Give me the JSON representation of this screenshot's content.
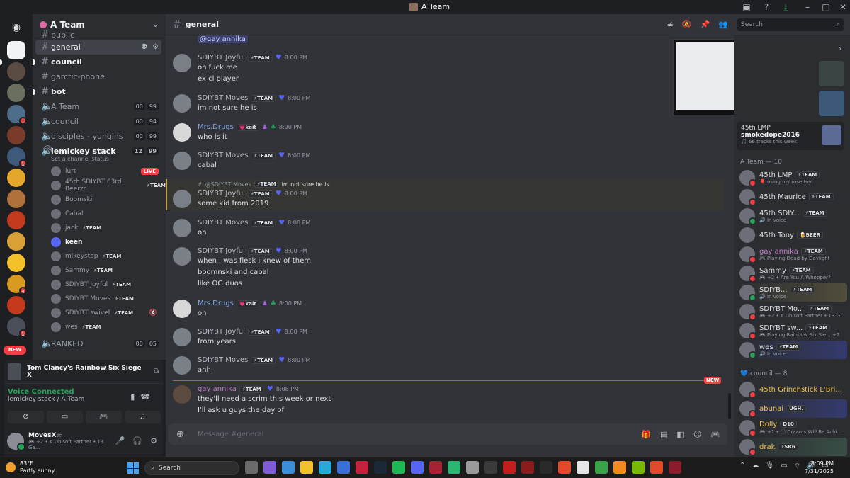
{
  "window": {
    "title": "A Team"
  },
  "server": {
    "name": "A Team",
    "new_label": "NEW"
  },
  "channels": [
    {
      "name": "public",
      "type": "text"
    },
    {
      "name": "general",
      "type": "text",
      "active": true
    },
    {
      "name": "council",
      "type": "text",
      "unread": true
    },
    {
      "name": "garctic-phone",
      "type": "text"
    },
    {
      "name": "bot",
      "type": "text",
      "unread": true
    },
    {
      "name": "A Team",
      "type": "voice",
      "c1": "00",
      "c2": "99"
    },
    {
      "name": "council",
      "type": "voice",
      "c1": "00",
      "c2": "94"
    },
    {
      "name": "disciples - yungins",
      "type": "voice",
      "c1": "00",
      "c2": "99"
    },
    {
      "name": "lemickey stack",
      "type": "voice",
      "c1": "12",
      "c2": "99",
      "status": "Set a channel status"
    }
  ],
  "voice_users": [
    {
      "name": "lurt",
      "live": "LIVE"
    },
    {
      "name": "45th SDIYBT 63rd Beerzr",
      "tag": "⚡TEAM"
    },
    {
      "name": "Boomski"
    },
    {
      "name": "Cabal"
    },
    {
      "name": "jack",
      "tag": "⚡TEAM"
    },
    {
      "name": "keen",
      "bold": true
    },
    {
      "name": "mikeystop",
      "tag": "⚡TEAM"
    },
    {
      "name": "Sammy",
      "tag": "⚡TEAM"
    },
    {
      "name": "SDIYBT Joyful",
      "tag": "⚡TEAM"
    },
    {
      "name": "SDIYBT Moves",
      "tag": "⚡TEAM"
    },
    {
      "name": "SDIYBT swivel",
      "tag": "⚡TEAM",
      "muted": true
    },
    {
      "name": "wes",
      "tag": "⚡TEAM"
    }
  ],
  "ranked": {
    "name": "RANKED",
    "c1": "00",
    "c2": "05"
  },
  "activity": {
    "game": "Tom Clancy's Rainbow Six Siege X",
    "voice_status": "Voice Connected",
    "voice_channel": "lemickey stack / A Team"
  },
  "user": {
    "name": "MovesX☆",
    "status": "🎮 +2 • ∀ Ubisoft Partner • T3 Ga..."
  },
  "chat": {
    "channel": "general",
    "mention": "@gay annika",
    "reply_preview": "@SDIYBT Moves",
    "reply_tag": "⚡TEAM",
    "reply_text": "im not sure he is",
    "new_label": "NEW",
    "placeholder": "Message #general",
    "messages": [
      {
        "author": "SDIYBT Joyful",
        "tag": "⚡TEAM",
        "time": "8:00 PM",
        "lines": [
          "oh fuck me",
          "ex cl player"
        ]
      },
      {
        "author": "SDIYBT Moves",
        "tag": "⚡TEAM",
        "time": "8:00 PM",
        "lines": [
          "im not sure he is"
        ]
      },
      {
        "author": "Mrs.Drugs",
        "tag": "💗kait",
        "time": "8:00 PM",
        "lines": [
          "who is it"
        ]
      },
      {
        "author": "SDIYBT Moves",
        "tag": "⚡TEAM",
        "time": "8:00 PM",
        "lines": [
          "cabal"
        ]
      },
      {
        "author": "SDIYBT Joyful",
        "tag": "⚡TEAM",
        "time": "8:00 PM",
        "lines": [
          "some kid from 2019"
        ]
      },
      {
        "author": "SDIYBT Moves",
        "tag": "⚡TEAM",
        "time": "8:00 PM",
        "lines": [
          "oh"
        ]
      },
      {
        "author": "SDIYBT Joyful",
        "tag": "⚡TEAM",
        "time": "8:00 PM",
        "lines": [
          "when i was flesk i knew of them",
          "boomnski and cabal",
          "like OG duos"
        ]
      },
      {
        "author": "Mrs.Drugs",
        "tag": "💗kait",
        "time": "8:00 PM",
        "lines": [
          "oh"
        ]
      },
      {
        "author": "SDIYBT Joyful",
        "tag": "⚡TEAM",
        "time": "8:00 PM",
        "lines": [
          "from years"
        ]
      },
      {
        "author": "SDIYBT Moves",
        "tag": "⚡TEAM",
        "time": "8:00 PM",
        "lines": [
          "ahh"
        ]
      },
      {
        "author": "gay annika",
        "tag": "⚡TEAM",
        "time": "8:08 PM",
        "lines": [
          "they'll need a scrim this week or next",
          "I'll ask u guys the day of"
        ]
      }
    ]
  },
  "search": {
    "placeholder": "Search"
  },
  "members": {
    "lmp_card": {
      "a": "45th LMP",
      "b": "smokedope2016",
      "c": "🎵 66 tracks this week"
    },
    "group1": "A Team — 10",
    "list1": [
      {
        "name": "45th LMP",
        "tag": "⚡TEAM",
        "status": "🎈 using my rose toy"
      },
      {
        "name": "45th Maurice",
        "tag": "⚡TEAM",
        "status": ""
      },
      {
        "name": "45th SDIY...",
        "tag": "⚡TEAM",
        "status": "🔊 In voice"
      },
      {
        "name": "45th Tony",
        "tag": "🍺BEER",
        "status": ""
      },
      {
        "name": "gay annika",
        "tag": "⚡TEAM",
        "status": "🎮 Playing Dead by Daylight"
      },
      {
        "name": "Sammy",
        "tag": "⚡TEAM",
        "status": "🎮 +2 • Are You A Whopper?"
      },
      {
        "name": "SDIYB...",
        "tag": "⚡TEAM",
        "status": "🔊 In voice"
      },
      {
        "name": "SDIYBT Mo...",
        "tag": "⚡TEAM",
        "status": "🎮 +2 • ∀ Ubisoft Partner • T3 G..."
      },
      {
        "name": "SDIYBT sw...",
        "tag": "⚡TEAM",
        "status": "🎮 Playing Rainbow Six Sie... +2"
      },
      {
        "name": "wes",
        "tag": "⚡TEAM",
        "status": "🔊 In voice"
      }
    ],
    "group2": "💙 council — 8",
    "list2": [
      {
        "name": "45th Grinchstick L'Bri...",
        "tag": "",
        "status": ""
      },
      {
        "name": "abunai",
        "tag": "UGH.",
        "status": ""
      },
      {
        "name": "Dolly",
        "tag": "D10",
        "status": "🎮 +1 • ⓘ Dreams Will Be Achi..."
      },
      {
        "name": "drak",
        "tag": "⚡SR6",
        "status": ""
      }
    ]
  },
  "taskbar": {
    "temp": "83°F",
    "weather": "Partly sunny",
    "search": "Search",
    "time": "8:09 PM",
    "date": "7/31/2025"
  }
}
